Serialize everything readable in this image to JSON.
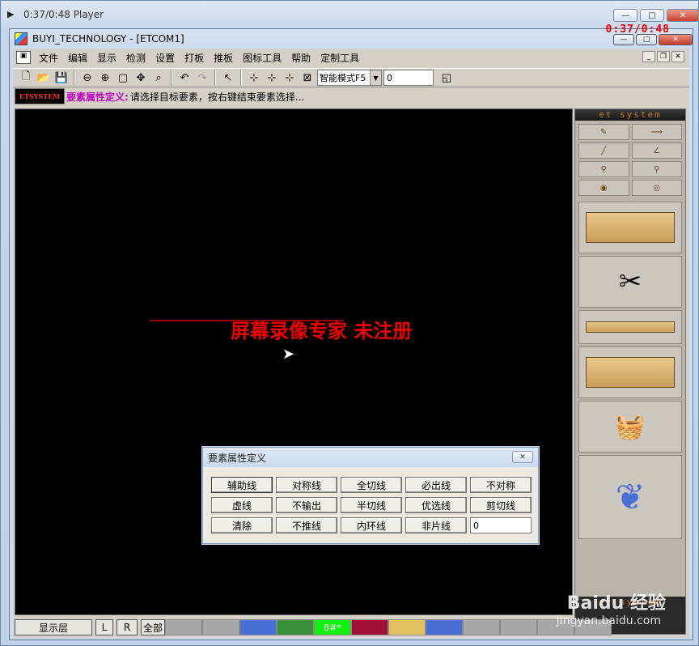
{
  "outer_window": {
    "title": "0:37/0:48 Player"
  },
  "app_window": {
    "title": "BUYI_TECHNOLOGY - [ETCOM1]",
    "timer": "0:37/0:48"
  },
  "menu": [
    "文件",
    "编辑",
    "显示",
    "检测",
    "设置",
    "打板",
    "推板",
    "图标工具",
    "帮助",
    "定制工具"
  ],
  "toolbar": {
    "mode": "智能模式F5",
    "value": "0"
  },
  "status": {
    "brand": "ETSYSTEM",
    "label": "要素属性定义:",
    "text": "请选择目标要素，按右键结束要素选择..."
  },
  "canvas": {
    "watermark": "屏幕录像专家  未注册"
  },
  "sidebar": {
    "header": "et system",
    "footer_header": "et system"
  },
  "dialog": {
    "title": "要素属性定义",
    "buttons": [
      "辅助线",
      "对称线",
      "全切线",
      "必出线",
      "不对称",
      "虚线",
      "不输出",
      "半切线",
      "优选线",
      "剪切线",
      "清除",
      "不推线",
      "内环线",
      "非片线"
    ],
    "input_value": "0"
  },
  "layerbar": {
    "label": "显示层",
    "left": "L",
    "right": "R",
    "all": "全部",
    "active_swatch": "8#*"
  },
  "swatch_colors": [
    "#a8a8a8",
    "#a8a8a8",
    "#4a6fd6",
    "#3a8f3a",
    "#12f012",
    "#a0103a",
    "#e0c060",
    "#4a6fd6",
    "#a8a8a8",
    "#a8a8a8",
    "#a8a8a8",
    "#a8a8a8"
  ],
  "watermark_site": {
    "brand": "Baidu 经验",
    "url": "jingyan.baidu.com"
  }
}
